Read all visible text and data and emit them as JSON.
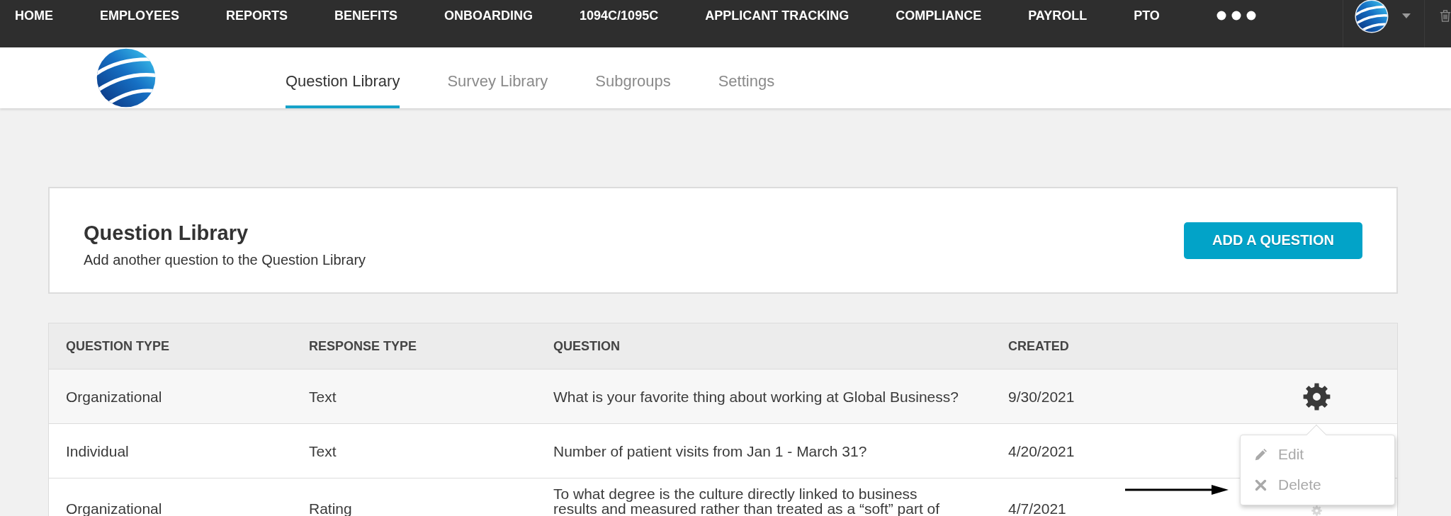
{
  "top_nav": {
    "items": [
      {
        "label": "HOME"
      },
      {
        "label": "EMPLOYEES"
      },
      {
        "label": "REPORTS"
      },
      {
        "label": "BENEFITS"
      },
      {
        "label": "ONBOARDING"
      },
      {
        "label": "1094C/1095C"
      },
      {
        "label": "APPLICANT TRACKING"
      },
      {
        "label": "COMPLIANCE"
      },
      {
        "label": "PAYROLL"
      },
      {
        "label": "PTO"
      }
    ]
  },
  "sub_nav": {
    "tabs": [
      {
        "label": "Question Library",
        "selected": true
      },
      {
        "label": "Survey Library",
        "selected": false
      },
      {
        "label": "Subgroups",
        "selected": false
      },
      {
        "label": "Settings",
        "selected": false
      }
    ]
  },
  "header_card": {
    "title": "Question Library",
    "subtitle": "Add another question to the Question Library",
    "button": "ADD A QUESTION"
  },
  "table": {
    "columns": [
      "QUESTION TYPE",
      "RESPONSE TYPE",
      "QUESTION",
      "CREATED"
    ],
    "rows": [
      {
        "question_type": "Organizational",
        "response_type": "Text",
        "question": "What is your favorite thing about working at Global Business?",
        "created": "9/30/2021",
        "settings": {
          "active": true
        },
        "menu": {
          "items": [
            {
              "kind": "edit",
              "label": "Edit"
            },
            {
              "kind": "delete",
              "label": "Delete"
            }
          ]
        }
      },
      {
        "question_type": "Individual",
        "response_type": "Text",
        "question": "Number of patient visits from Jan 1 - March 31?",
        "created": "4/20/2021"
      },
      {
        "question_type": "Organizational",
        "response_type": "Rating",
        "question": "To what degree is the culture directly linked to business results and measured rather than treated as a “soft” part of",
        "created": "4/7/2021",
        "settings": {
          "active": false
        }
      }
    ]
  }
}
